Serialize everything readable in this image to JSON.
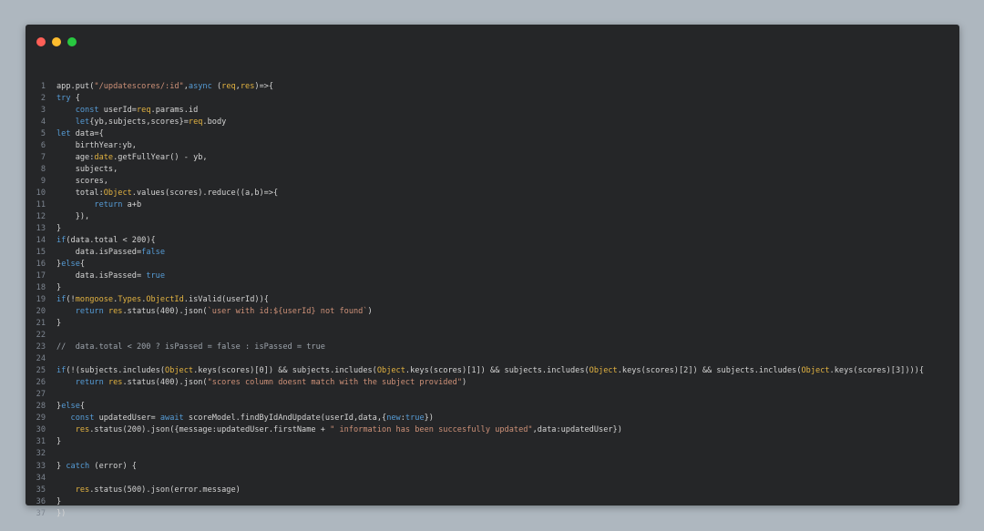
{
  "window": {
    "controls": [
      "close",
      "minimize",
      "maximize"
    ],
    "colors": {
      "close": "#ff5f57",
      "minimize": "#febc2e",
      "maximize": "#28c840",
      "background": "#252628",
      "page": "#aeb7bf"
    }
  },
  "code": {
    "lines": [
      {
        "n": "1",
        "text": "app.put(\"/updatescores/:id\",async (req,res)=>{"
      },
      {
        "n": "2",
        "text": "try {"
      },
      {
        "n": "3",
        "text": "    const userId=req.params.id"
      },
      {
        "n": "4",
        "text": "    let{yb,subjects,scores}=req.body"
      },
      {
        "n": "5",
        "text": "let data={"
      },
      {
        "n": "6",
        "text": "    birthYear:yb,"
      },
      {
        "n": "7",
        "text": "    age:date.getFullYear() - yb,"
      },
      {
        "n": "8",
        "text": "    subjects,"
      },
      {
        "n": "9",
        "text": "    scores,"
      },
      {
        "n": "10",
        "text": "    total:Object.values(scores).reduce((a,b)=>{"
      },
      {
        "n": "11",
        "text": "        return a+b"
      },
      {
        "n": "12",
        "text": "    }),"
      },
      {
        "n": "13",
        "text": "}"
      },
      {
        "n": "14",
        "text": "if(data.total < 200){"
      },
      {
        "n": "15",
        "text": "    data.isPassed=false"
      },
      {
        "n": "16",
        "text": "}else{"
      },
      {
        "n": "17",
        "text": "    data.isPassed= true"
      },
      {
        "n": "18",
        "text": "}"
      },
      {
        "n": "19",
        "text": "if(!mongoose.Types.ObjectId.isValid(userId)){"
      },
      {
        "n": "20",
        "text": "    return res.status(400).json(`user with id:${userId} not found`)"
      },
      {
        "n": "21",
        "text": "}"
      },
      {
        "n": "22",
        "text": ""
      },
      {
        "n": "23",
        "text": "//  data.total < 200 ? isPassed = false : isPassed = true"
      },
      {
        "n": "24",
        "text": ""
      },
      {
        "n": "25",
        "text": "if(!(subjects.includes(Object.keys(scores)[0]) && subjects.includes(Object.keys(scores)[1]) && subjects.includes(Object.keys(scores)[2]) && subjects.includes(Object.keys(scores)[3]))){"
      },
      {
        "n": "26",
        "text": "    return res.status(400).json(\"scores column doesnt match with the subject provided\")"
      },
      {
        "n": "27",
        "text": ""
      },
      {
        "n": "28",
        "text": "}else{"
      },
      {
        "n": "29",
        "text": "   const updatedUser= await scoreModel.findByIdAndUpdate(userId,data,{new:true})"
      },
      {
        "n": "30",
        "text": "    res.status(200).json({message:updatedUser.firstName + \" information has been succesfully updated\",data:updatedUser})"
      },
      {
        "n": "31",
        "text": "}"
      },
      {
        "n": "32",
        "text": ""
      },
      {
        "n": "33",
        "text": "} catch (error) {"
      },
      {
        "n": "34",
        "text": ""
      },
      {
        "n": "35",
        "text": "    res.status(500).json(error.message)"
      },
      {
        "n": "36",
        "text": "}"
      },
      {
        "n": "37",
        "text": "})"
      }
    ]
  }
}
